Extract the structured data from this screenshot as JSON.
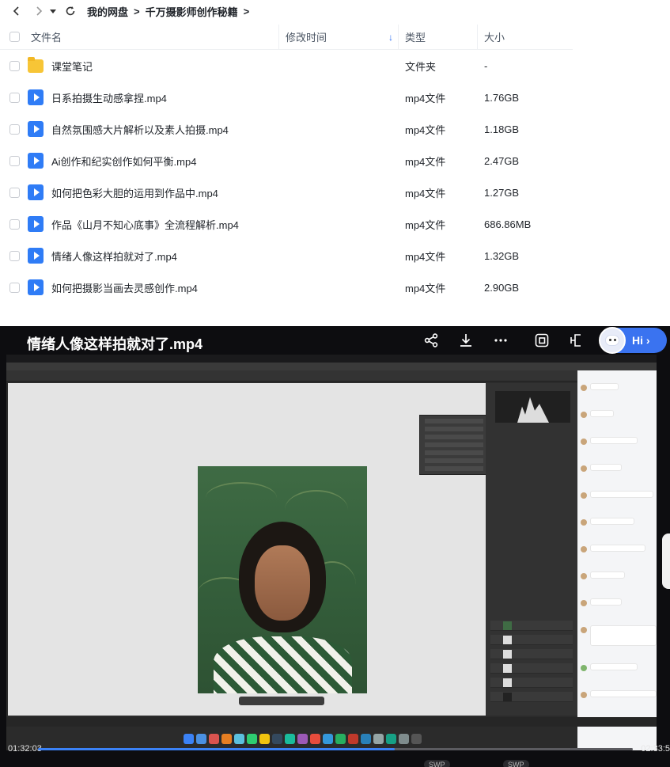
{
  "breadcrumb": {
    "root": "我的网盘",
    "sep": ">",
    "current": "千万摄影师创作秘籍",
    "trail_sep": ">"
  },
  "table": {
    "headers": {
      "name": "文件名",
      "time": "修改时间",
      "type": "类型",
      "size": "大小"
    },
    "rows": [
      {
        "name": "课堂笔记",
        "type": "文件夹",
        "size": "-",
        "icon": "folder-icon"
      },
      {
        "name": "日系拍摄生动感拿捏.mp4",
        "type": "mp4文件",
        "size": "1.76GB",
        "icon": "video-file-icon"
      },
      {
        "name": "自然氛围感大片解析以及素人拍摄.mp4",
        "type": "mp4文件",
        "size": "1.18GB",
        "icon": "video-file-icon"
      },
      {
        "name": "Ai创作和纪实创作如何平衡.mp4",
        "type": "mp4文件",
        "size": "2.47GB",
        "icon": "video-file-icon"
      },
      {
        "name": "如何把色彩大胆的运用到作品中.mp4",
        "type": "mp4文件",
        "size": "1.27GB",
        "icon": "video-file-icon"
      },
      {
        "name": "作品《山月不知心底事》全流程解析.mp4",
        "type": "mp4文件",
        "size": "686.86MB",
        "icon": "video-file-icon"
      },
      {
        "name": "情绪人像这样拍就对了.mp4",
        "type": "mp4文件",
        "size": "1.32GB",
        "icon": "video-file-icon"
      },
      {
        "name": "如何把摄影当画去灵感创作.mp4",
        "type": "mp4文件",
        "size": "2.90GB",
        "icon": "video-file-icon"
      }
    ]
  },
  "player": {
    "title": "情绪人像这样拍就对了.mp4",
    "hi_label": "Hi ›",
    "time_current": "01:32:03",
    "time_total": "02:33:5",
    "progress": 0.6,
    "swp_label": "SWP",
    "accent": "#3b82f6"
  },
  "colors": {
    "folder": "#f7c536",
    "video_file": "#2f7cf6",
    "sort_arrow": "#2f6ff5"
  }
}
